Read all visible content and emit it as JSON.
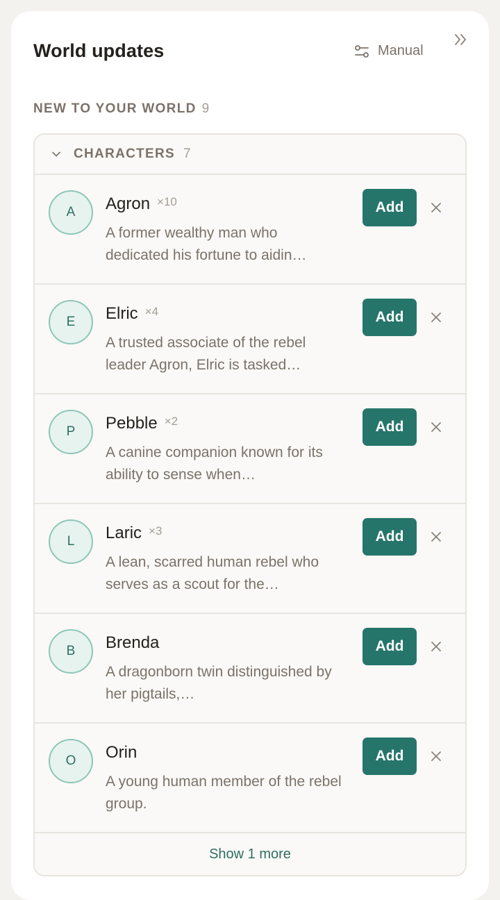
{
  "header": {
    "title": "World updates",
    "mode_label": "Manual",
    "mode_icon": "sliders-icon",
    "collapse_icon": "double-chevron-right-icon"
  },
  "section": {
    "heading": "NEW TO YOUR WORLD",
    "count": "9"
  },
  "group": {
    "title": "CHARACTERS",
    "count": "7",
    "toggle_icon": "chevron-down-icon",
    "show_more_label": "Show 1 more",
    "add_label": "Add",
    "items": [
      {
        "initial": "A",
        "name": "Agron",
        "mult": "×10",
        "desc": "A former wealthy man who dedicated his fortune to aidin…"
      },
      {
        "initial": "E",
        "name": "Elric",
        "mult": "×4",
        "desc": "A trusted associate of the rebel leader Agron, Elric is tasked…"
      },
      {
        "initial": "P",
        "name": "Pebble",
        "mult": "×2",
        "desc": "A canine companion known for its ability to sense when…"
      },
      {
        "initial": "L",
        "name": "Laric",
        "mult": "×3",
        "desc": "A lean, scarred human rebel who serves as a scout for the…"
      },
      {
        "initial": "B",
        "name": "Brenda",
        "mult": "",
        "desc": "A dragonborn twin distinguished by her pigtails,…"
      },
      {
        "initial": "O",
        "name": "Orin",
        "mult": "",
        "desc": "A young human member of the rebel group."
      }
    ]
  },
  "colors": {
    "accent": "#26756b",
    "avatar_bg": "#e7f3ef",
    "avatar_border": "#8dc6b8",
    "muted_text": "#7b7269"
  }
}
